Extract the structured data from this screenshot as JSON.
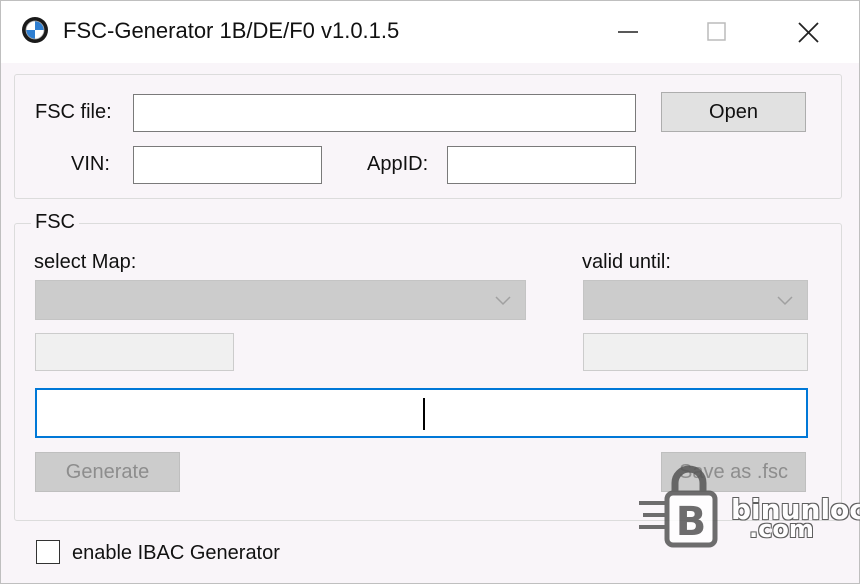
{
  "window": {
    "title": "FSC-Generator 1B/DE/F0 v1.0.1.5"
  },
  "icons": {
    "app": "bmw-logo-icon",
    "minimize": "minimize-icon",
    "maximize": "maximize-icon",
    "close": "close-icon"
  },
  "file_group": {
    "fsc_file_label": "FSC file:",
    "fsc_file_value": "",
    "open_button": "Open",
    "vin_label": "VIN:",
    "vin_value": "",
    "appid_label": "AppID:",
    "appid_value": ""
  },
  "fsc_group": {
    "legend": "FSC",
    "select_map_label": "select Map:",
    "select_map_value": "",
    "valid_until_label": "valid until:",
    "valid_until_value": "",
    "map_text_value": "",
    "valid_text_value": "",
    "code_value": "",
    "generate_button": "Generate",
    "save_button": "Save as .fsc"
  },
  "footer": {
    "ibac_checkbox_label": "enable IBAC Generator",
    "ibac_checked": false
  },
  "watermark": {
    "line1": "binunlock",
    "line2": ".com"
  },
  "colors": {
    "focus_border": "#0078d7",
    "disabled_fill": "#cccccc",
    "window_bg": "#f9f5f9"
  }
}
